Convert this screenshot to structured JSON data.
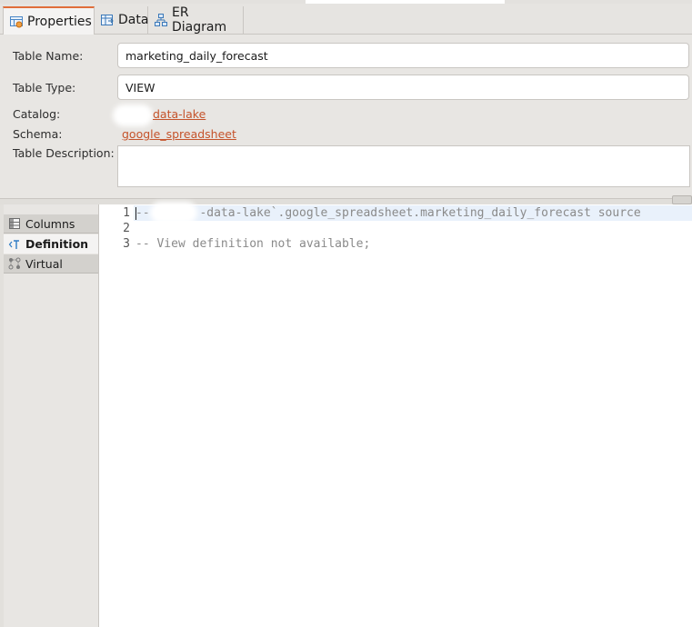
{
  "tabs": [
    {
      "label": "Properties",
      "icon": "properties-icon",
      "active": true
    },
    {
      "label": "Data",
      "icon": "data-grid-icon",
      "active": false
    },
    {
      "label": "ER Diagram",
      "icon": "er-diagram-icon",
      "active": false
    }
  ],
  "properties": {
    "table_name_label": "Table Name:",
    "table_name_value": "marketing_daily_forecast",
    "table_type_label": "Table Type:",
    "table_type_value": "VIEW",
    "catalog_label": "Catalog:",
    "catalog_value": "data-lake",
    "schema_label": "Schema:",
    "schema_value": "google_spreadsheet",
    "description_label": "Table Description:",
    "description_value": ""
  },
  "sidebar": {
    "items": [
      {
        "label": "Columns",
        "icon": "columns-icon",
        "active": false
      },
      {
        "label": "Definition",
        "icon": "definition-icon",
        "active": true
      },
      {
        "label": "Virtual",
        "icon": "virtual-icon",
        "active": false
      }
    ]
  },
  "editor": {
    "lines": [
      {
        "number": "1",
        "text": "--       -data-lake`.google_spreadsheet.marketing_daily_forecast source"
      },
      {
        "number": "2",
        "text": ""
      },
      {
        "number": "3",
        "text": "-- View definition not available;"
      }
    ]
  },
  "colors": {
    "accent": "#e06d3a",
    "link": "#c5532b",
    "panel_bg": "#e8e6e3"
  }
}
